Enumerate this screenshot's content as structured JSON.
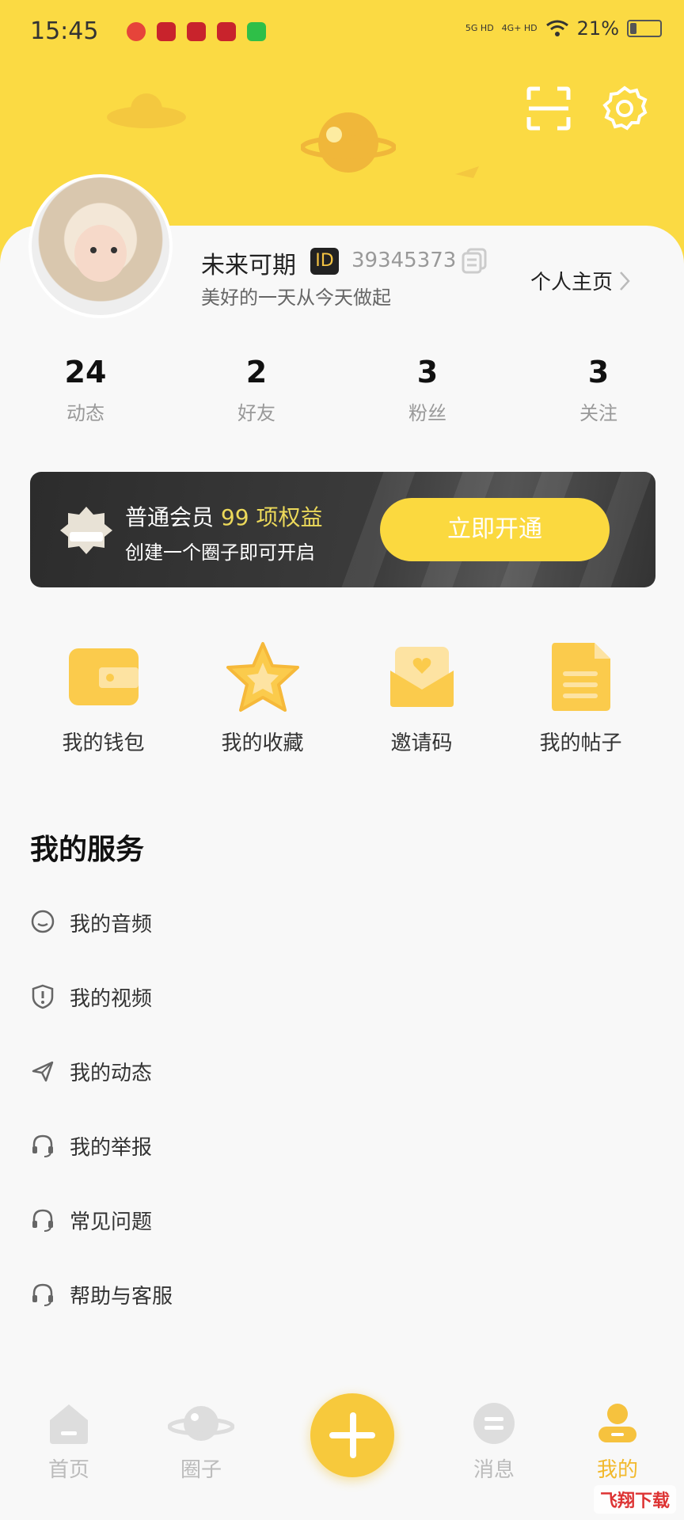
{
  "status_bar": {
    "time": "15:45",
    "signal1": "5G HD",
    "signal2": "4G+ HD",
    "battery": "21%",
    "battery_level": 0.21
  },
  "profile": {
    "name": "未来可期",
    "id_badge": "ID",
    "user_id": "39345373",
    "bio": "美好的一天从今天做起",
    "homepage_link": "个人主页"
  },
  "stats": [
    {
      "value": "24",
      "label": "动态"
    },
    {
      "value": "2",
      "label": "好友"
    },
    {
      "value": "3",
      "label": "粉丝"
    },
    {
      "value": "3",
      "label": "关注"
    }
  ],
  "member": {
    "level": "普通会员",
    "benefit_count": "99 项权益",
    "subtitle": "创建一个圈子即可开启",
    "button": "立即开通"
  },
  "quick_entries": [
    {
      "label": "我的钱包",
      "icon": "wallet-icon"
    },
    {
      "label": "我的收藏",
      "icon": "star-icon"
    },
    {
      "label": "邀请码",
      "icon": "mail-heart-icon"
    },
    {
      "label": "我的帖子",
      "icon": "document-icon"
    }
  ],
  "services": {
    "title": "我的服务",
    "items": [
      {
        "label": "我的音频",
        "icon": "chat-bubble-icon"
      },
      {
        "label": "我的视频",
        "icon": "shield-alert-icon"
      },
      {
        "label": "我的动态",
        "icon": "send-icon"
      },
      {
        "label": "我的举报",
        "icon": "headset-icon"
      },
      {
        "label": "常见问题",
        "icon": "headset-icon"
      },
      {
        "label": "帮助与客服",
        "icon": "headset-icon"
      }
    ]
  },
  "tabbar": {
    "items": [
      {
        "label": "首页",
        "icon": "home-icon"
      },
      {
        "label": "圈子",
        "icon": "planet-icon"
      },
      {
        "label": "",
        "icon": "plus-icon"
      },
      {
        "label": "消息",
        "icon": "message-icon"
      },
      {
        "label": "我的",
        "icon": "profile-icon"
      }
    ],
    "active": "我的"
  },
  "watermark": "飞翔下载",
  "colors": {
    "brand_yellow": "#fbda43",
    "accent": "#f2b92c",
    "benefit": "#ecd95a"
  }
}
